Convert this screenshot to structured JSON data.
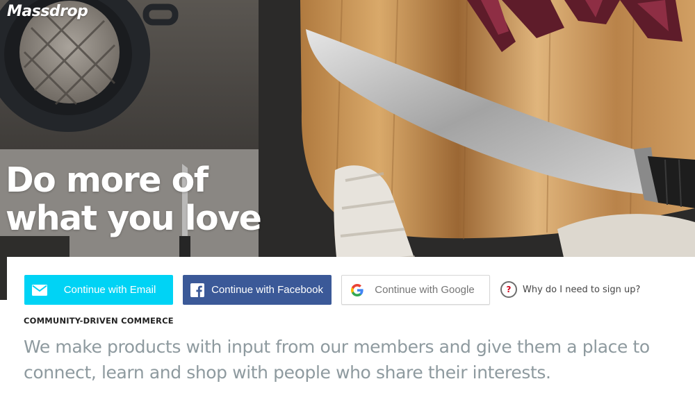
{
  "brand": {
    "logo_text": "Massdrop"
  },
  "hero": {
    "headline_line1": "Do more of",
    "headline_line2": "what you love"
  },
  "auth": {
    "email_label": "Continue with Email",
    "facebook_label": "Continue with Facebook",
    "google_label": "Continue with Google",
    "why_label": "Why do I need to sign up?",
    "why_icon_glyph": "?"
  },
  "about": {
    "eyebrow": "COMMUNITY-DRIVEN COMMERCE",
    "tagline": "We make products with input from our members and give them a place to connect, learn and shop with people who share their interests."
  },
  "icons": {
    "email": "envelope-icon",
    "facebook": "facebook-icon",
    "google": "google-icon",
    "why": "question-icon"
  },
  "colors": {
    "email_button": "#00d3f5",
    "facebook_button": "#3b5998",
    "google_button_border": "#d6d6d6",
    "tagline_text": "#8e9a9f",
    "why_icon_accent": "#d0021b"
  }
}
